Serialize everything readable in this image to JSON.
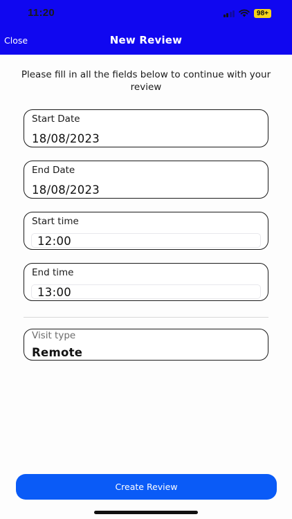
{
  "status_bar": {
    "time": "11:20",
    "battery": "98+",
    "icons": [
      "signal-icon",
      "wifi-icon",
      "battery-icon"
    ]
  },
  "nav": {
    "close_label": "Close",
    "title": "New Review",
    "header_color": "#1007f0"
  },
  "form": {
    "instructions": "Please fill in all the fields below to continue with your review",
    "start_date": {
      "label": "Start Date",
      "value": "18/08/2023"
    },
    "end_date": {
      "label": "End Date",
      "value": "18/08/2023"
    },
    "start_time": {
      "label": "Start time",
      "value": "12:00"
    },
    "end_time": {
      "label": "End time",
      "value": "13:00"
    },
    "visit_type": {
      "label": "Visit type",
      "value": "Remote"
    }
  },
  "actions": {
    "create_label": "Create Review",
    "button_color": "#0a5bf7"
  }
}
